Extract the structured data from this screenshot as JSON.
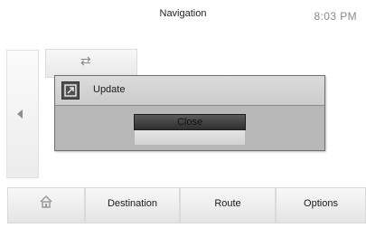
{
  "header": {
    "title": "Navigation",
    "clock": "8:03 PM"
  },
  "left_panel": {
    "arrow_icon": "chevron-left-icon"
  },
  "tile": {
    "icon": "map-route-icon"
  },
  "dialog": {
    "icon": "update-icon",
    "title": "Update",
    "close_label": "Close"
  },
  "bottom_bar": {
    "home_icon": "home-icon",
    "items": [
      {
        "label": "Destination"
      },
      {
        "label": "Route"
      },
      {
        "label": "Options"
      }
    ]
  },
  "colors": {
    "dialog_background": "#b8b8b8",
    "dialog_header": "#d4d4d4",
    "close_button": "#3a3a3a",
    "clock_text": "#8a8a8a"
  }
}
